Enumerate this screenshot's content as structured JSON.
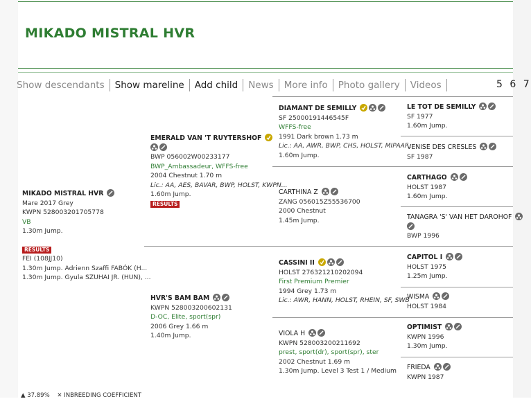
{
  "page": {
    "title": "MIKADO MISTRAL HVR"
  },
  "tabs": [
    {
      "label": "Show descendants",
      "state": "dim"
    },
    {
      "label": "Show mareline",
      "state": "active"
    },
    {
      "label": "Add child",
      "state": "active"
    },
    {
      "label": "News",
      "state": "dim"
    },
    {
      "label": "More info",
      "state": "dim"
    },
    {
      "label": "Photo gallery",
      "state": "dim"
    },
    {
      "label": "Videos",
      "state": "dim"
    }
  ],
  "pager": "5 6 7",
  "subject": {
    "name": "MIKADO MISTRAL  HVR",
    "line1": "Mare 2017 Grey",
    "line2": "KWPN 528003201705778",
    "line3": "VB",
    "jump": "1.30m Jump.",
    "results_label": "RESULTS",
    "fei": "FEI (108JJ10)",
    "r1": "1.30m Jump. Adrienn Szaffi FABÓK (H...",
    "r2": "1.30m Jump. Gyula SZUHAI JR. (HUN), ..."
  },
  "sire": {
    "name": "EMERALD VAN 'T RUYTERSHOF",
    "reg": "BWP 056002W00233177",
    "pred": "BWP_Ambassadeur, WFFS-free",
    "info": "2004 Chestnut 1.70 m",
    "lic": "Lic.: AA, AES, BAVAR, BWP, HOLST, KWPN...",
    "jump": "1.60m Jump.",
    "results_label": "RESULTS"
  },
  "dam": {
    "name": "HVR'S BAM BAM",
    "reg": "KWPN 528003200602131",
    "pred": "D-OC, Elite, sport(spr)",
    "info": "2006 Grey 1.66 m",
    "jump": "1.40m Jump."
  },
  "ss": {
    "name": "DIAMANT DE SEMILLY",
    "reg": "SF 25000191446545F",
    "pred": "WFFS-free",
    "info": "1991 Dark brown 1.73 m",
    "lic": "Lic.: AA, AWR, BWP, CHS, HOLST, MIPAAF...",
    "jump": "1.60m Jump."
  },
  "sd": {
    "name": "CARTHINA Z",
    "reg": "ZANG 056015Z55536700",
    "info": "2000 Chestnut",
    "jump": "1.45m Jump."
  },
  "ds": {
    "name": "CASSINI II",
    "reg": "HOLST 276321210202094",
    "pred": "First Premium Premier",
    "info": "1994 Grey 1.73 m",
    "lic": "Lic.: AWR, HANN, HOLST, RHEIN, SF, SWB"
  },
  "dd": {
    "name": "VIOLA H",
    "reg": "KWPN 528003200211692",
    "pred": "prest, sport(dr), sport(spr), ster",
    "info": "2002 Chestnut 1.69 m",
    "jump": "1.30m Jump. Level 3 Test 1 / Medium"
  },
  "g4": [
    {
      "name": "LE TOT DE SEMILLY",
      "l1": "SF 1977",
      "l2": "1.60m Jump."
    },
    {
      "name": "VENISE DES CRESLES",
      "l1": "SF 1987",
      "l2": ""
    },
    {
      "name": "CARTHAGO",
      "l1": "HOLST 1987",
      "l2": "1.60m Jump."
    },
    {
      "name": "TANAGRA 'S' VAN HET DAROHOF",
      "l1": "BWP 1996",
      "l2": ""
    },
    {
      "name": "CAPITOL I",
      "l1": "HOLST 1975",
      "l2": "1.25m Jump."
    },
    {
      "name": "WISMA",
      "l1": "HOLST 1984",
      "l2": ""
    },
    {
      "name": "OPTIMIST",
      "l1": "KWPN 1996",
      "l2": "1.30m Jump."
    },
    {
      "name": "FRIEDA",
      "l1": "KWPN 1987",
      "l2": ""
    }
  ],
  "footer": {
    "percent": "37.89%",
    "coef": "INBREEDING COEFFICIENT"
  },
  "colors": {
    "accent": "#2e7d32",
    "results": "#b71c1c",
    "approved": "#c9a800"
  }
}
